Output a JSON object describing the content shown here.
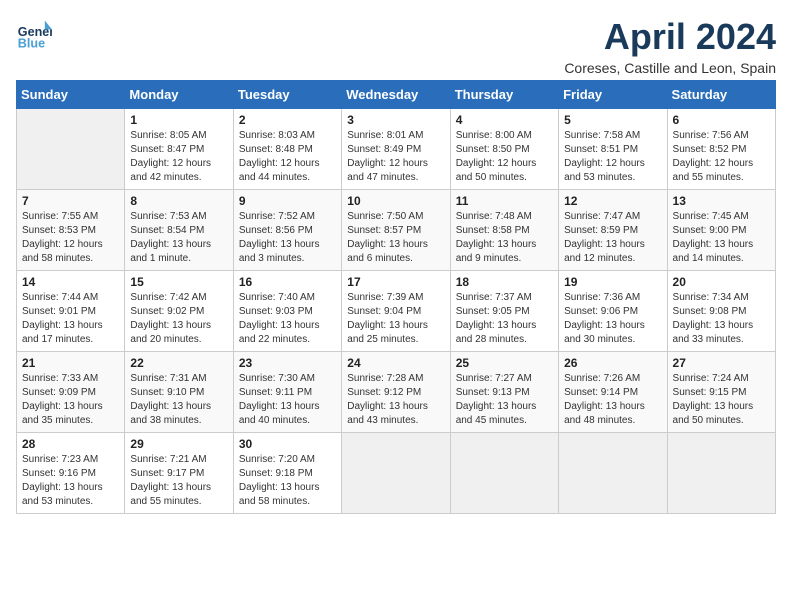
{
  "logo": {
    "line1": "General",
    "line2": "Blue"
  },
  "title": "April 2024",
  "subtitle": "Coreses, Castille and Leon, Spain",
  "weekdays": [
    "Sunday",
    "Monday",
    "Tuesday",
    "Wednesday",
    "Thursday",
    "Friday",
    "Saturday"
  ],
  "weeks": [
    [
      {
        "num": "",
        "info": ""
      },
      {
        "num": "1",
        "info": "Sunrise: 8:05 AM\nSunset: 8:47 PM\nDaylight: 12 hours\nand 42 minutes."
      },
      {
        "num": "2",
        "info": "Sunrise: 8:03 AM\nSunset: 8:48 PM\nDaylight: 12 hours\nand 44 minutes."
      },
      {
        "num": "3",
        "info": "Sunrise: 8:01 AM\nSunset: 8:49 PM\nDaylight: 12 hours\nand 47 minutes."
      },
      {
        "num": "4",
        "info": "Sunrise: 8:00 AM\nSunset: 8:50 PM\nDaylight: 12 hours\nand 50 minutes."
      },
      {
        "num": "5",
        "info": "Sunrise: 7:58 AM\nSunset: 8:51 PM\nDaylight: 12 hours\nand 53 minutes."
      },
      {
        "num": "6",
        "info": "Sunrise: 7:56 AM\nSunset: 8:52 PM\nDaylight: 12 hours\nand 55 minutes."
      }
    ],
    [
      {
        "num": "7",
        "info": "Sunrise: 7:55 AM\nSunset: 8:53 PM\nDaylight: 12 hours\nand 58 minutes."
      },
      {
        "num": "8",
        "info": "Sunrise: 7:53 AM\nSunset: 8:54 PM\nDaylight: 13 hours\nand 1 minute."
      },
      {
        "num": "9",
        "info": "Sunrise: 7:52 AM\nSunset: 8:56 PM\nDaylight: 13 hours\nand 3 minutes."
      },
      {
        "num": "10",
        "info": "Sunrise: 7:50 AM\nSunset: 8:57 PM\nDaylight: 13 hours\nand 6 minutes."
      },
      {
        "num": "11",
        "info": "Sunrise: 7:48 AM\nSunset: 8:58 PM\nDaylight: 13 hours\nand 9 minutes."
      },
      {
        "num": "12",
        "info": "Sunrise: 7:47 AM\nSunset: 8:59 PM\nDaylight: 13 hours\nand 12 minutes."
      },
      {
        "num": "13",
        "info": "Sunrise: 7:45 AM\nSunset: 9:00 PM\nDaylight: 13 hours\nand 14 minutes."
      }
    ],
    [
      {
        "num": "14",
        "info": "Sunrise: 7:44 AM\nSunset: 9:01 PM\nDaylight: 13 hours\nand 17 minutes."
      },
      {
        "num": "15",
        "info": "Sunrise: 7:42 AM\nSunset: 9:02 PM\nDaylight: 13 hours\nand 20 minutes."
      },
      {
        "num": "16",
        "info": "Sunrise: 7:40 AM\nSunset: 9:03 PM\nDaylight: 13 hours\nand 22 minutes."
      },
      {
        "num": "17",
        "info": "Sunrise: 7:39 AM\nSunset: 9:04 PM\nDaylight: 13 hours\nand 25 minutes."
      },
      {
        "num": "18",
        "info": "Sunrise: 7:37 AM\nSunset: 9:05 PM\nDaylight: 13 hours\nand 28 minutes."
      },
      {
        "num": "19",
        "info": "Sunrise: 7:36 AM\nSunset: 9:06 PM\nDaylight: 13 hours\nand 30 minutes."
      },
      {
        "num": "20",
        "info": "Sunrise: 7:34 AM\nSunset: 9:08 PM\nDaylight: 13 hours\nand 33 minutes."
      }
    ],
    [
      {
        "num": "21",
        "info": "Sunrise: 7:33 AM\nSunset: 9:09 PM\nDaylight: 13 hours\nand 35 minutes."
      },
      {
        "num": "22",
        "info": "Sunrise: 7:31 AM\nSunset: 9:10 PM\nDaylight: 13 hours\nand 38 minutes."
      },
      {
        "num": "23",
        "info": "Sunrise: 7:30 AM\nSunset: 9:11 PM\nDaylight: 13 hours\nand 40 minutes."
      },
      {
        "num": "24",
        "info": "Sunrise: 7:28 AM\nSunset: 9:12 PM\nDaylight: 13 hours\nand 43 minutes."
      },
      {
        "num": "25",
        "info": "Sunrise: 7:27 AM\nSunset: 9:13 PM\nDaylight: 13 hours\nand 45 minutes."
      },
      {
        "num": "26",
        "info": "Sunrise: 7:26 AM\nSunset: 9:14 PM\nDaylight: 13 hours\nand 48 minutes."
      },
      {
        "num": "27",
        "info": "Sunrise: 7:24 AM\nSunset: 9:15 PM\nDaylight: 13 hours\nand 50 minutes."
      }
    ],
    [
      {
        "num": "28",
        "info": "Sunrise: 7:23 AM\nSunset: 9:16 PM\nDaylight: 13 hours\nand 53 minutes."
      },
      {
        "num": "29",
        "info": "Sunrise: 7:21 AM\nSunset: 9:17 PM\nDaylight: 13 hours\nand 55 minutes."
      },
      {
        "num": "30",
        "info": "Sunrise: 7:20 AM\nSunset: 9:18 PM\nDaylight: 13 hours\nand 58 minutes."
      },
      {
        "num": "",
        "info": ""
      },
      {
        "num": "",
        "info": ""
      },
      {
        "num": "",
        "info": ""
      },
      {
        "num": "",
        "info": ""
      }
    ]
  ]
}
